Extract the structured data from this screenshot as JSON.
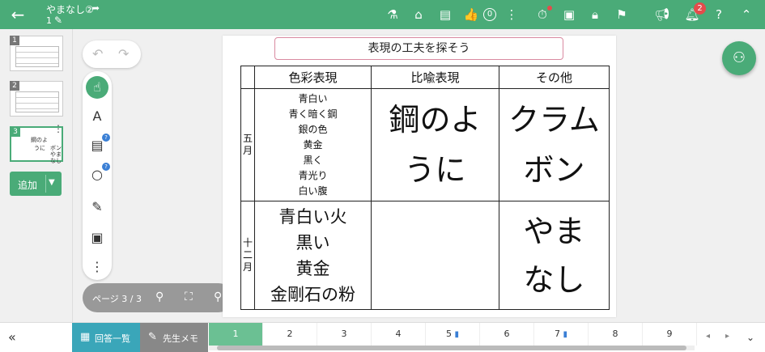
{
  "header": {
    "title": "やまなし②",
    "subtitle": "1",
    "like_count": "0",
    "notification_count": "2",
    "icons": [
      "back-arrow-icon",
      "share-icon",
      "pencil-icon",
      "flask-icon",
      "presenter-icon",
      "chat-icon",
      "thumbs-up-icon",
      "more-vert-icon",
      "timer-icon",
      "screen-lock-icon",
      "lock-icon",
      "group-icon",
      "megaphone-icon",
      "bell-icon",
      "help-icon",
      "chevron-up-icon"
    ]
  },
  "sidebar": {
    "thumbnails": [
      {
        "num": "1"
      },
      {
        "num": "2"
      },
      {
        "num": "3",
        "mini": [
          "鋼のよ",
          "うに",
          "ボン",
          "やま",
          "なし"
        ]
      }
    ],
    "add_label": "追加"
  },
  "pagebar": {
    "label": "ページ 3 / 3"
  },
  "document": {
    "title": "表現の工夫を探そう",
    "columns": [
      "色彩表現",
      "比喩表現",
      "その他"
    ],
    "rows": [
      {
        "month": "五月",
        "color_list": [
          "青白い",
          "青く暗く鋼",
          "銀の色",
          "黄金",
          "黒く",
          "青光り",
          "白い腹"
        ],
        "metaphor": [
          "鋼のよ",
          "うに"
        ],
        "other": [
          "クラム",
          "ボン"
        ]
      },
      {
        "month": "十二月",
        "color_list": [
          "青白い火",
          "黒い",
          "黄金",
          "金剛石の粉"
        ],
        "metaphor": [],
        "other": [
          "やま",
          "なし"
        ]
      }
    ]
  },
  "bottom": {
    "answers_label": "回答一覧",
    "memo_label": "先生メモ",
    "page_tabs": [
      {
        "num": "1",
        "active": true,
        "doc": false
      },
      {
        "num": "2",
        "doc": false
      },
      {
        "num": "3",
        "doc": false
      },
      {
        "num": "4",
        "doc": false
      },
      {
        "num": "5",
        "doc": true
      },
      {
        "num": "6",
        "doc": false
      },
      {
        "num": "7",
        "doc": true
      },
      {
        "num": "8",
        "doc": false
      },
      {
        "num": "9",
        "doc": false
      }
    ]
  },
  "colors": {
    "accent": "#4aab78",
    "answers": "#3aa6b9",
    "badge": "#e54b4b"
  }
}
